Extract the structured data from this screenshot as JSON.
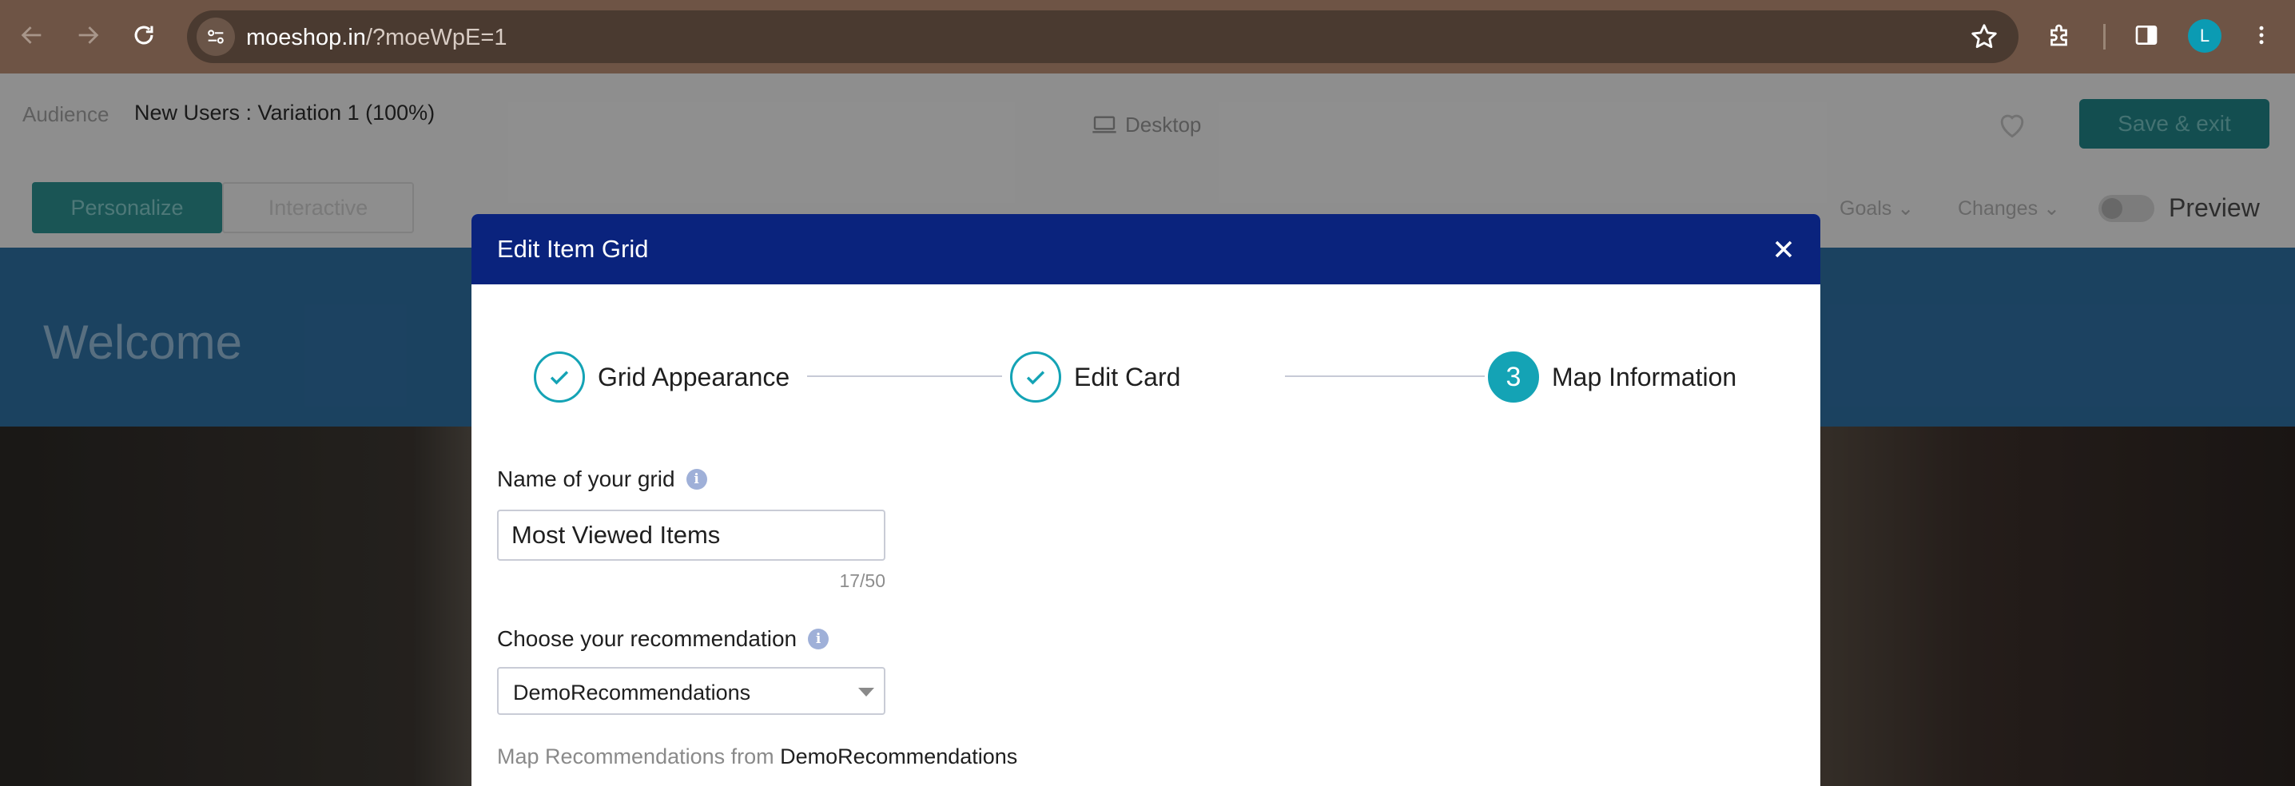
{
  "browser": {
    "url_host": "moeshop.in",
    "url_path": "/?moeWpE=1",
    "profile_initial": "L",
    "icons": [
      "back-icon",
      "forward-icon",
      "reload-icon",
      "site-info-icon",
      "bookmark-star-icon",
      "extensions-icon",
      "side-panel-icon",
      "more-icon"
    ]
  },
  "app": {
    "audience_label": "Audience",
    "audience_value": "New Users : Variation 1 (100%)",
    "device": "Desktop",
    "save_exit": "Save & exit",
    "tabs": [
      "Personalize",
      "Interactive"
    ],
    "goals": "Goals",
    "changes": "Changes",
    "preview": "Preview",
    "hero_text": "Welcome"
  },
  "modal": {
    "title": "Edit Item Grid",
    "steps": [
      {
        "label": "Grid Appearance",
        "state": "done"
      },
      {
        "label": "Edit Card",
        "state": "done"
      },
      {
        "label": "Map Information",
        "state": "active",
        "number": "3"
      }
    ],
    "grid_name": {
      "label": "Name of your grid",
      "value": "Most Viewed Items",
      "counter": "17/50"
    },
    "recommendation": {
      "label": "Choose your recommendation",
      "value": "DemoRecommendations"
    },
    "map_line": {
      "prefix": "Map Recommendations from",
      "source": "DemoRecommendations"
    },
    "colors": {
      "header": "#0a237d",
      "accent": "#14a3b5"
    }
  }
}
